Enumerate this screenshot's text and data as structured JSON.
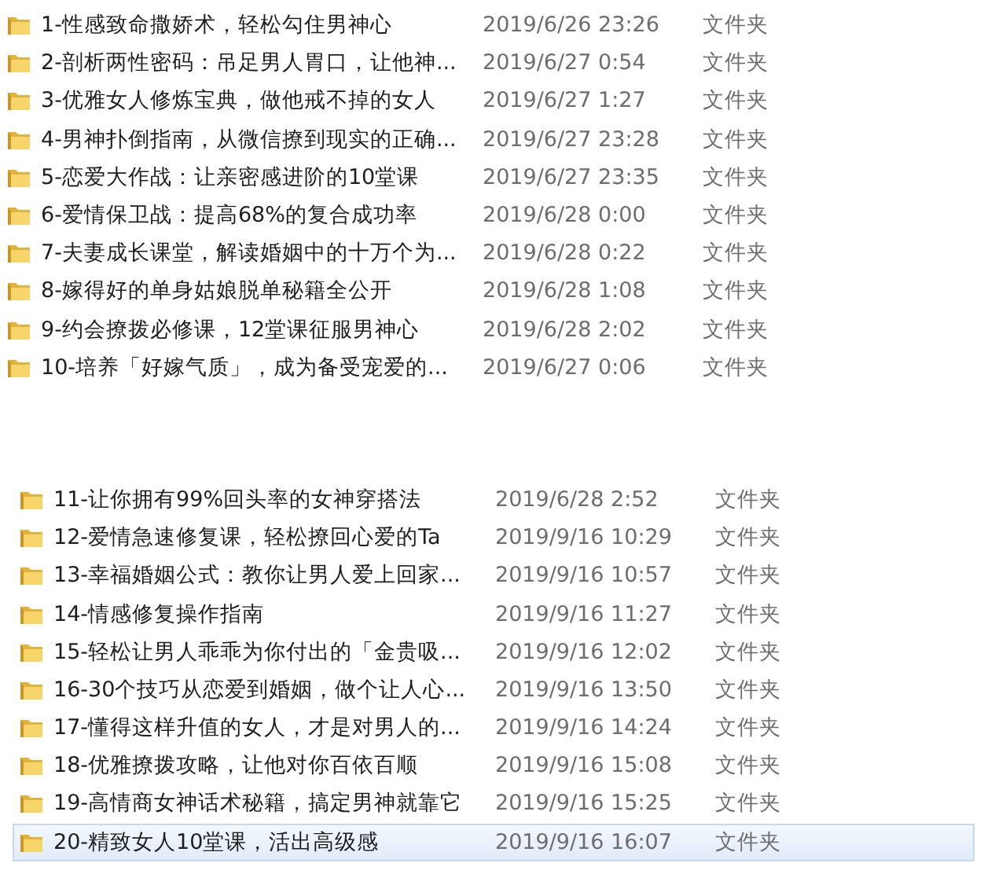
{
  "panels": [
    {
      "rows": [
        {
          "name": "1-性感致命撒娇术，轻松勾住男神心",
          "date": "2019/6/26 23:26",
          "type": "文件夹",
          "selected": false
        },
        {
          "name": "2-剖析两性密码：吊足男人胃口，让他神...",
          "date": "2019/6/27 0:54",
          "type": "文件夹",
          "selected": false
        },
        {
          "name": "3-优雅女人修炼宝典，做他戒不掉的女人",
          "date": "2019/6/27 1:27",
          "type": "文件夹",
          "selected": false
        },
        {
          "name": "4-男神扑倒指南，从微信撩到现实的正确...",
          "date": "2019/6/27 23:28",
          "type": "文件夹",
          "selected": false
        },
        {
          "name": "5-恋爱大作战：让亲密感进阶的10堂课",
          "date": "2019/6/27 23:35",
          "type": "文件夹",
          "selected": false
        },
        {
          "name": "6-爱情保卫战：提高68%的复合成功率",
          "date": "2019/6/28 0:00",
          "type": "文件夹",
          "selected": false
        },
        {
          "name": "7-夫妻成长课堂，解读婚姻中的十万个为...",
          "date": "2019/6/28 0:22",
          "type": "文件夹",
          "selected": false
        },
        {
          "name": "8-嫁得好的单身姑娘脱单秘籍全公开",
          "date": "2019/6/28 1:08",
          "type": "文件夹",
          "selected": false
        },
        {
          "name": "9-约会撩拨必修课，12堂课征服男神心",
          "date": "2019/6/28 2:02",
          "type": "文件夹",
          "selected": false
        },
        {
          "name": "10-培养「好嫁气质」，成为备受宠爱的...",
          "date": "2019/6/27 0:06",
          "type": "文件夹",
          "selected": false
        }
      ]
    },
    {
      "rows": [
        {
          "name": "11-让你拥有99%回头率的女神穿搭法",
          "date": "2019/6/28 2:52",
          "type": "文件夹",
          "selected": false
        },
        {
          "name": "12-爱情急速修复课，轻松撩回心爱的Ta",
          "date": "2019/9/16 10:29",
          "type": "文件夹",
          "selected": false
        },
        {
          "name": "13-幸福婚姻公式：教你让男人爱上回家...",
          "date": "2019/9/16 10:57",
          "type": "文件夹",
          "selected": false
        },
        {
          "name": "14-情感修复操作指南",
          "date": "2019/9/16 11:27",
          "type": "文件夹",
          "selected": false
        },
        {
          "name": "15-轻松让男人乖乖为你付出的「金贵吸...",
          "date": "2019/9/16 12:02",
          "type": "文件夹",
          "selected": false
        },
        {
          "name": "16-30个技巧从恋爱到婚姻，做个让人心...",
          "date": "2019/9/16 13:50",
          "type": "文件夹",
          "selected": false
        },
        {
          "name": "17-懂得这样升值的女人，才是对男人的...",
          "date": "2019/9/16 14:24",
          "type": "文件夹",
          "selected": false
        },
        {
          "name": "18-优雅撩拨攻略，让他对你百依百顺",
          "date": "2019/9/16 15:08",
          "type": "文件夹",
          "selected": false
        },
        {
          "name": "19-高情商女神话术秘籍，搞定男神就靠它",
          "date": "2019/9/16 15:25",
          "type": "文件夹",
          "selected": false
        },
        {
          "name": "20-精致女人10堂课，活出高级感",
          "date": "2019/9/16 16:07",
          "type": "文件夹",
          "selected": true
        }
      ]
    }
  ]
}
